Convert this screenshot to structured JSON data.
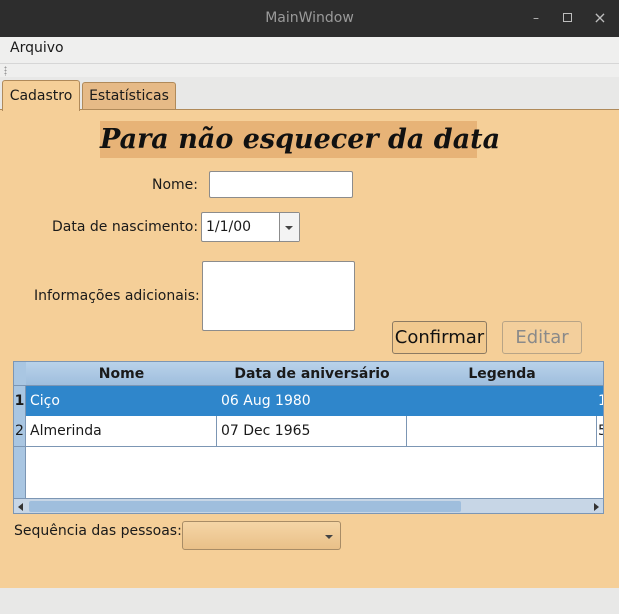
{
  "window": {
    "title": "MainWindow",
    "minimize": "–",
    "maximize": "▫",
    "close": "×"
  },
  "menu": {
    "items": [
      "Arquivo"
    ]
  },
  "tabs": [
    {
      "label": "Cadastro",
      "active": true
    },
    {
      "label": "Estatísticas",
      "active": false
    }
  ],
  "form": {
    "heading": "Para não esquecer da data",
    "nome_label": "Nome:",
    "nome_value": "",
    "data_label": "Data de nascimento:",
    "data_value": "1/1/00",
    "info_label": "Informações adicionais:",
    "info_value": "",
    "confirm_label": "Confirmar",
    "edit_label": "Editar"
  },
  "table": {
    "columns": [
      "Nome",
      "Data de aniversário",
      "Legenda"
    ],
    "rows": [
      {
        "index": "1",
        "nome": "Ciço",
        "data": "06 Aug 1980",
        "legenda": "",
        "extra": "1"
      },
      {
        "index": "2",
        "nome": "Almerinda",
        "data": "07 Dec 1965",
        "legenda": "",
        "extra": "5"
      }
    ]
  },
  "sequence": {
    "label": "Sequência das pessoas:",
    "value": ""
  },
  "colors": {
    "panel": "#f5cf98",
    "heading_bg": "#e7b377",
    "selection": "#2f86cb",
    "table_header": "#a9c6e2"
  }
}
